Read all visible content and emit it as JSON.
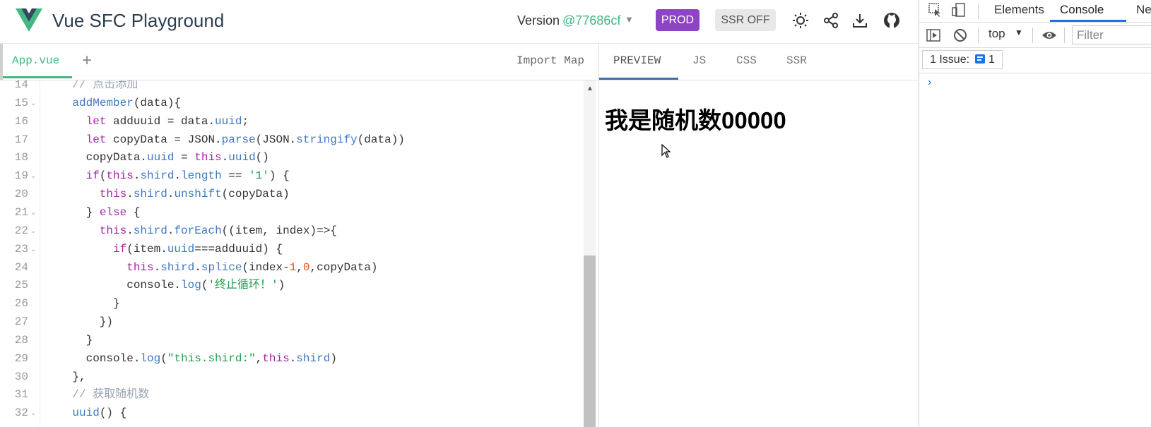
{
  "header": {
    "title": "Vue SFC Playground",
    "version_label": "Version",
    "version_value": "@77686cf",
    "prod_label": "PROD",
    "ssr_label": "SSR OFF",
    "icons": [
      "sun-icon",
      "share-icon",
      "download-icon",
      "github-icon"
    ],
    "accent_color": "#42b883",
    "prod_color": "#8e44c5"
  },
  "editor": {
    "file_tab": "App.vue",
    "add_label": "+",
    "import_map_label": "Import Map",
    "lines": [
      {
        "n": "14",
        "fold": false,
        "t": [
          [
            "cm",
            "    // 点击添加"
          ]
        ]
      },
      {
        "n": "15",
        "fold": true,
        "t": [
          [
            "fn",
            "    addMember"
          ],
          [
            "",
            "(data){"
          ]
        ]
      },
      {
        "n": "16",
        "fold": false,
        "t": [
          [
            "kw",
            "      let "
          ],
          [
            "",
            "adduuid = data."
          ],
          [
            "prop",
            "uuid"
          ],
          [
            "",
            ";"
          ]
        ]
      },
      {
        "n": "17",
        "fold": false,
        "t": [
          [
            "kw",
            "      let "
          ],
          [
            "",
            "copyData = JSON."
          ],
          [
            "fn",
            "parse"
          ],
          [
            "",
            "(JSON."
          ],
          [
            "fn",
            "stringify"
          ],
          [
            "",
            "(data))"
          ]
        ]
      },
      {
        "n": "18",
        "fold": false,
        "t": [
          [
            "",
            "      copyData."
          ],
          [
            "prop",
            "uuid"
          ],
          [
            "",
            " = "
          ],
          [
            "kw",
            "this"
          ],
          [
            "",
            "."
          ],
          [
            "fn",
            "uuid"
          ],
          [
            "",
            "()"
          ]
        ]
      },
      {
        "n": "19",
        "fold": true,
        "t": [
          [
            "kw",
            "      if"
          ],
          [
            "",
            "("
          ],
          [
            "kw",
            "this"
          ],
          [
            "",
            "."
          ],
          [
            "prop",
            "shird"
          ],
          [
            "",
            "."
          ],
          [
            "prop",
            "length"
          ],
          [
            "",
            " == "
          ],
          [
            "str",
            "'1'"
          ],
          [
            "",
            ") {"
          ]
        ]
      },
      {
        "n": "20",
        "fold": false,
        "t": [
          [
            "kw",
            "        this"
          ],
          [
            "",
            "."
          ],
          [
            "prop",
            "shird"
          ],
          [
            "",
            "."
          ],
          [
            "fn",
            "unshift"
          ],
          [
            "",
            "(copyData)"
          ]
        ]
      },
      {
        "n": "21",
        "fold": true,
        "t": [
          [
            "",
            "      } "
          ],
          [
            "kw",
            "else"
          ],
          [
            "",
            " {"
          ]
        ]
      },
      {
        "n": "22",
        "fold": true,
        "t": [
          [
            "kw",
            "        this"
          ],
          [
            "",
            "."
          ],
          [
            "prop",
            "shird"
          ],
          [
            "",
            "."
          ],
          [
            "fn",
            "forEach"
          ],
          [
            "",
            "((item, index)=>{"
          ]
        ]
      },
      {
        "n": "23",
        "fold": true,
        "t": [
          [
            "kw",
            "          if"
          ],
          [
            "",
            "(item."
          ],
          [
            "prop",
            "uuid"
          ],
          [
            "",
            "===adduuid) {"
          ]
        ]
      },
      {
        "n": "24",
        "fold": false,
        "t": [
          [
            "kw",
            "            this"
          ],
          [
            "",
            "."
          ],
          [
            "prop",
            "shird"
          ],
          [
            "",
            "."
          ],
          [
            "fn",
            "splice"
          ],
          [
            "",
            "(index-"
          ],
          [
            "num",
            "1"
          ],
          [
            "",
            ","
          ],
          [
            "num",
            "0"
          ],
          [
            "",
            ",copyData)"
          ]
        ]
      },
      {
        "n": "25",
        "fold": false,
        "t": [
          [
            "",
            "            console."
          ],
          [
            "fn",
            "log"
          ],
          [
            "",
            "("
          ],
          [
            "str",
            "'终止循环！'"
          ],
          [
            "",
            ")"
          ]
        ]
      },
      {
        "n": "26",
        "fold": false,
        "t": [
          [
            "",
            "          }"
          ]
        ]
      },
      {
        "n": "27",
        "fold": false,
        "t": [
          [
            "",
            "        })"
          ]
        ]
      },
      {
        "n": "28",
        "fold": false,
        "t": [
          [
            "",
            "      }"
          ]
        ]
      },
      {
        "n": "29",
        "fold": false,
        "t": [
          [
            "",
            "      console."
          ],
          [
            "fn",
            "log"
          ],
          [
            "",
            "("
          ],
          [
            "str",
            "\"this.shird:\""
          ],
          [
            "",
            ","
          ],
          [
            "kw",
            "this"
          ],
          [
            "",
            "."
          ],
          [
            "prop",
            "shird"
          ],
          [
            "",
            ")"
          ]
        ]
      },
      {
        "n": "30",
        "fold": false,
        "t": [
          [
            "",
            "    },"
          ]
        ]
      },
      {
        "n": "31",
        "fold": false,
        "t": [
          [
            "cm",
            "    // 获取随机数"
          ]
        ]
      },
      {
        "n": "32",
        "fold": true,
        "t": [
          [
            "fn",
            "    uuid"
          ],
          [
            "",
            "() {"
          ]
        ]
      }
    ]
  },
  "output": {
    "tabs": [
      "PREVIEW",
      "JS",
      "CSS",
      "SSR"
    ],
    "active_tab": "PREVIEW",
    "preview_text": "我是随机数00000"
  },
  "devtools": {
    "tabs": [
      "Elements",
      "Console",
      "Netw"
    ],
    "active_tab": "Console",
    "context": "top",
    "filter_placeholder": "Filter",
    "issues_label": "1 Issue:",
    "issues_count": "1",
    "prompt": "›",
    "active_color": "#1a73e8"
  }
}
